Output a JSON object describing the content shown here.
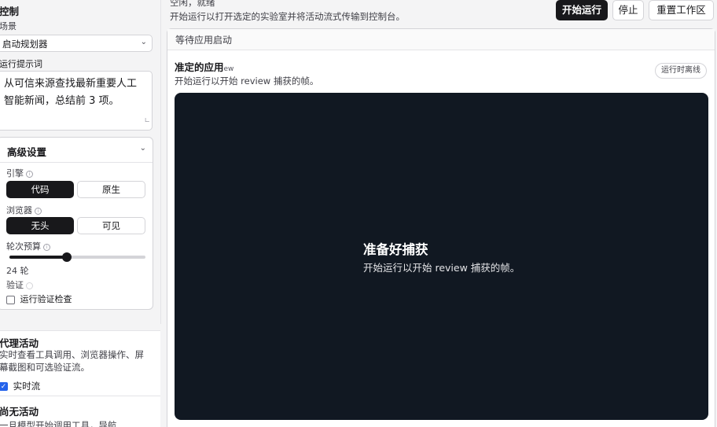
{
  "left": {
    "control_title": "控制",
    "scenario_label": "场景",
    "scenario_value": "启动规划器",
    "prompt_label": "运行提示词",
    "prompt_text": "从可信来源查找最新重要人工智能新闻，总结前 3 项。",
    "advanced": {
      "title": "高级设置",
      "engine_label": "引擎",
      "engine_options": [
        "代码",
        "原生"
      ],
      "engine_selected": "代码",
      "browser_label": "浏览器",
      "browser_options": [
        "无头",
        "可见"
      ],
      "browser_selected": "无头",
      "budget_label": "轮次预算",
      "budget_value": "24 轮",
      "budget_fraction": 0.42,
      "verify_label": "验证",
      "verify_checkbox_label": "运行验证检查",
      "verify_checked": false
    },
    "agent": {
      "title": "代理活动",
      "desc": "实时查看工具调用、浏览器操作、屏幕截图和可选验证流。",
      "live_label": "实时流",
      "live_checked": true,
      "empty_title": "尚无活动",
      "empty_desc": "一旦模型开始调用工具，导航"
    }
  },
  "topbar": {
    "status": "空闲，就绪",
    "hint": "开始运行以打开选定的实验室并将活动流式传输到控制台。",
    "run_label": "开始运行",
    "stop_label": "停止",
    "reset_label": "重置工作区"
  },
  "main": {
    "header": "等待应用启动",
    "app_title": "准定的应用",
    "app_title_suffix": "ew",
    "app_desc": "开始运行以开始 review 捕获的帧。",
    "status_pill": "运行时离线",
    "viewer_title": "准备好捕获",
    "viewer_sub": "开始运行以开始 review 捕获的帧。"
  },
  "colors": {
    "primary": "#18181b",
    "viewer_bg": "#111822",
    "checkbox_accent": "#2563eb"
  }
}
